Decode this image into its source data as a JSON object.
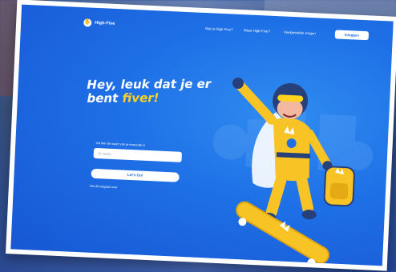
{
  "brand": {
    "name": "High-Five",
    "logo_icon": "hand-icon"
  },
  "nav": {
    "links": [
      "Wat is High-Five?",
      "Waar High-Five?",
      "Veelgestelde vragen"
    ],
    "login_label": "Inloggen"
  },
  "hero": {
    "headline_prefix": "Hey, leuk dat je er bent ",
    "headline_accent": "fiver!"
  },
  "form": {
    "name_label": "Vul hier de naam van je mascotte in",
    "name_placeholder": "Je naam",
    "submit_label": "Let's Go!",
    "skip_label": "Sla dit vergaan over"
  },
  "colors": {
    "background_blue": "#1e6fe6",
    "accent_yellow": "#ffd21f",
    "mascot_suit": "#f7c325"
  }
}
